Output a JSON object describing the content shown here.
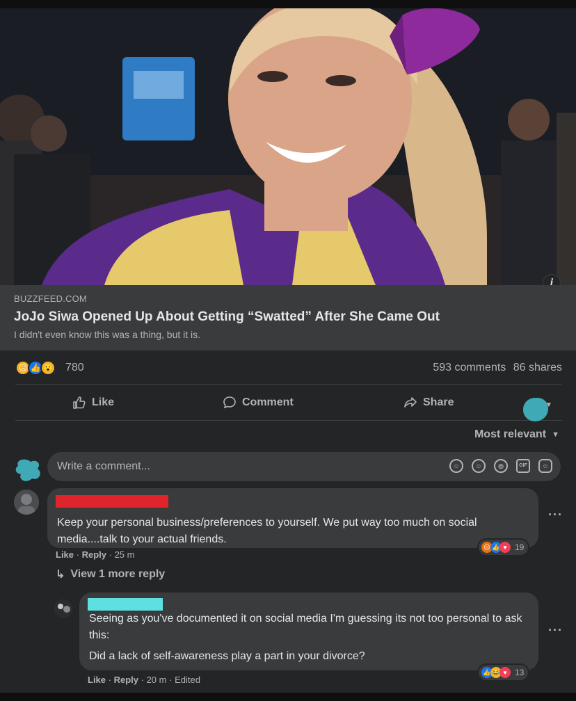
{
  "post": {
    "link_source": "BUZZFEED.COM",
    "headline": "JoJo Siwa Opened Up About Getting “Swatted” After She Came Out",
    "subtitle": "I didn't even know this was a thing, but it is.",
    "info_icon": "i",
    "reactions": {
      "icons": [
        "sad-reaction-icon",
        "like-reaction-icon",
        "wow-reaction-icon"
      ],
      "count": "780"
    },
    "comments_count": "593 comments",
    "shares_count": "86 shares"
  },
  "actions": {
    "like_label": "Like",
    "comment_label": "Comment",
    "share_label": "Share"
  },
  "sort_label": "Most relevant",
  "composer": {
    "placeholder": "Write a comment...",
    "icons": [
      "sticker-icon",
      "emoji-icon",
      "camera-icon",
      "gif-icon",
      "avatar-sticker-icon"
    ],
    "gif_label": "GIF"
  },
  "comments": [
    {
      "name": "",
      "text": "Keep your personal business/preferences to yourself. We put way too much on social media....talk to your actual friends.",
      "like_label": "Like",
      "reply_label": "Reply",
      "time": "25 m",
      "reaction_count": "19",
      "view_more_label": "View 1 more reply",
      "replies": [
        {
          "name": "",
          "text1": "Seeing as you've documented it on social media I'm guessing its not too personal to ask this:",
          "text2": "Did a lack of self-awareness play a part in your divorce?",
          "like_label": "Like",
          "reply_label": "Reply",
          "time": "20 m",
          "edited": "Edited",
          "reaction_count": "13"
        }
      ]
    }
  ],
  "colors": {
    "background": "#18191a",
    "card": "#242526",
    "bubble": "#3a3b3c",
    "text_primary": "#e4e6eb",
    "text_secondary": "#b0b3b8",
    "redaction_red": "#e0242b",
    "redaction_teal": "#5fe0e0",
    "avatar_scribble": "#3fa9b5"
  }
}
